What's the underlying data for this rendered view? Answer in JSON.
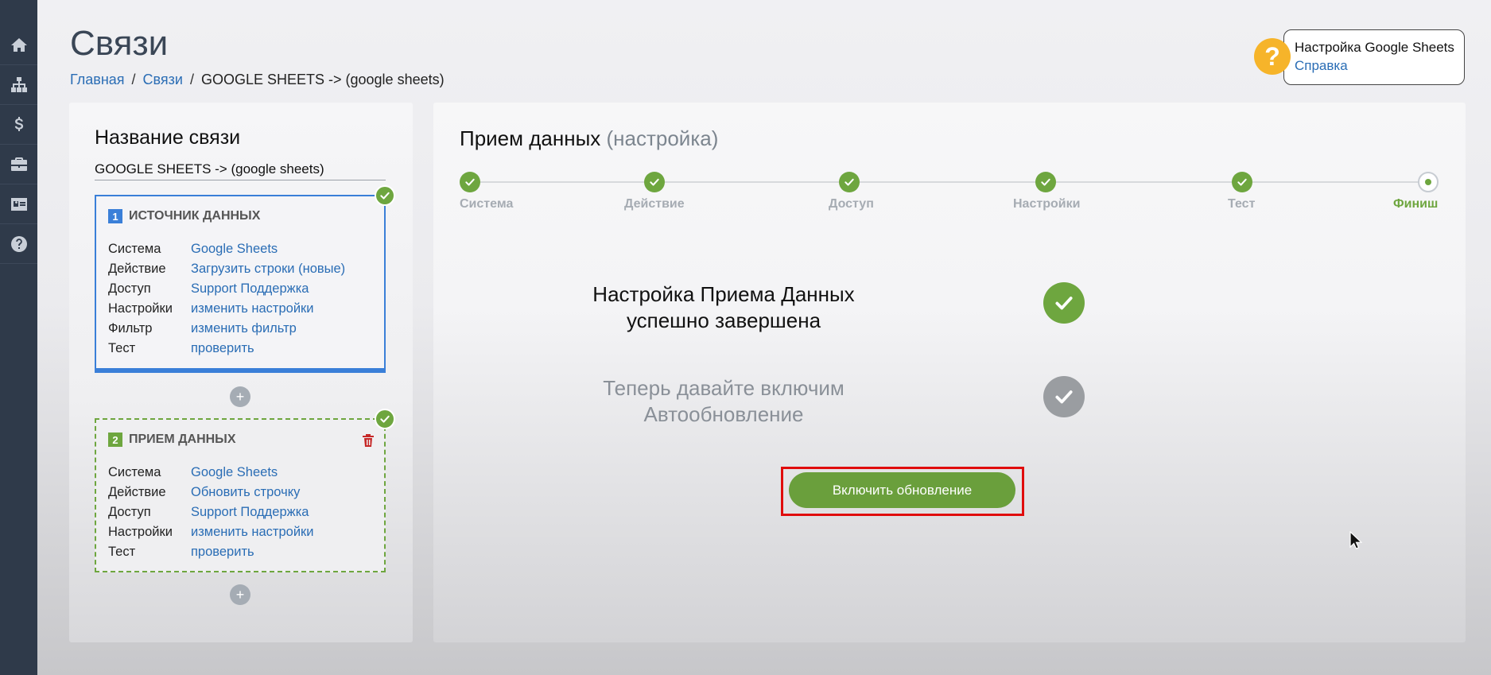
{
  "header": {
    "title": "Связи",
    "breadcrumb": {
      "home": "Главная",
      "links": "Связи",
      "current": "GOOGLE SHEETS -> (google sheets)"
    }
  },
  "help": {
    "icon": "question-icon",
    "symbol": "?",
    "title": "Настройка Google Sheets",
    "link": "Справка"
  },
  "sidebar": {
    "items": [
      {
        "name": "home-icon"
      },
      {
        "name": "sitemap-icon"
      },
      {
        "name": "dollar-icon"
      },
      {
        "name": "briefcase-icon"
      },
      {
        "name": "id-card-icon"
      },
      {
        "name": "help-circle-icon"
      }
    ]
  },
  "left_panel": {
    "title": "Название связи",
    "name_value": "GOOGLE SHEETS -> (google sheets)",
    "plus_symbol": "+",
    "source": {
      "num": "1",
      "title": "ИСТОЧНИК ДАННЫХ",
      "rows": [
        {
          "k": "Система",
          "v": "Google Sheets"
        },
        {
          "k": "Действие",
          "v": "Загрузить строки (новые)"
        },
        {
          "k": "Доступ",
          "v": "Support Поддержка"
        },
        {
          "k": "Настройки",
          "v": "изменить настройки"
        },
        {
          "k": "Фильтр",
          "v": "изменить фильтр"
        },
        {
          "k": "Тест",
          "v": "проверить"
        }
      ]
    },
    "dest": {
      "num": "2",
      "title": "ПРИЕМ ДАННЫХ",
      "rows": [
        {
          "k": "Система",
          "v": "Google Sheets"
        },
        {
          "k": "Действие",
          "v": "Обновить строчку"
        },
        {
          "k": "Доступ",
          "v": "Support Поддержка"
        },
        {
          "k": "Настройки",
          "v": "изменить настройки"
        },
        {
          "k": "Тест",
          "v": "проверить"
        }
      ]
    }
  },
  "main": {
    "title": "Прием данных",
    "subtitle": "(настройка)",
    "steps": [
      "Система",
      "Действие",
      "Доступ",
      "Настройки",
      "Тест",
      "Финиш"
    ],
    "done_line1": "Настройка Приема Данных",
    "done_line2": "успешно завершена",
    "next_line1": "Теперь давайте включим",
    "next_line2": "Автообновление",
    "enable_button": "Включить обновление"
  },
  "colors": {
    "accent_green": "#6ea63f",
    "link_blue": "#2a6db5",
    "sidebar": "#2f3a4a",
    "highlight_red": "#e00c0c",
    "help_yellow": "#f6b42a"
  }
}
